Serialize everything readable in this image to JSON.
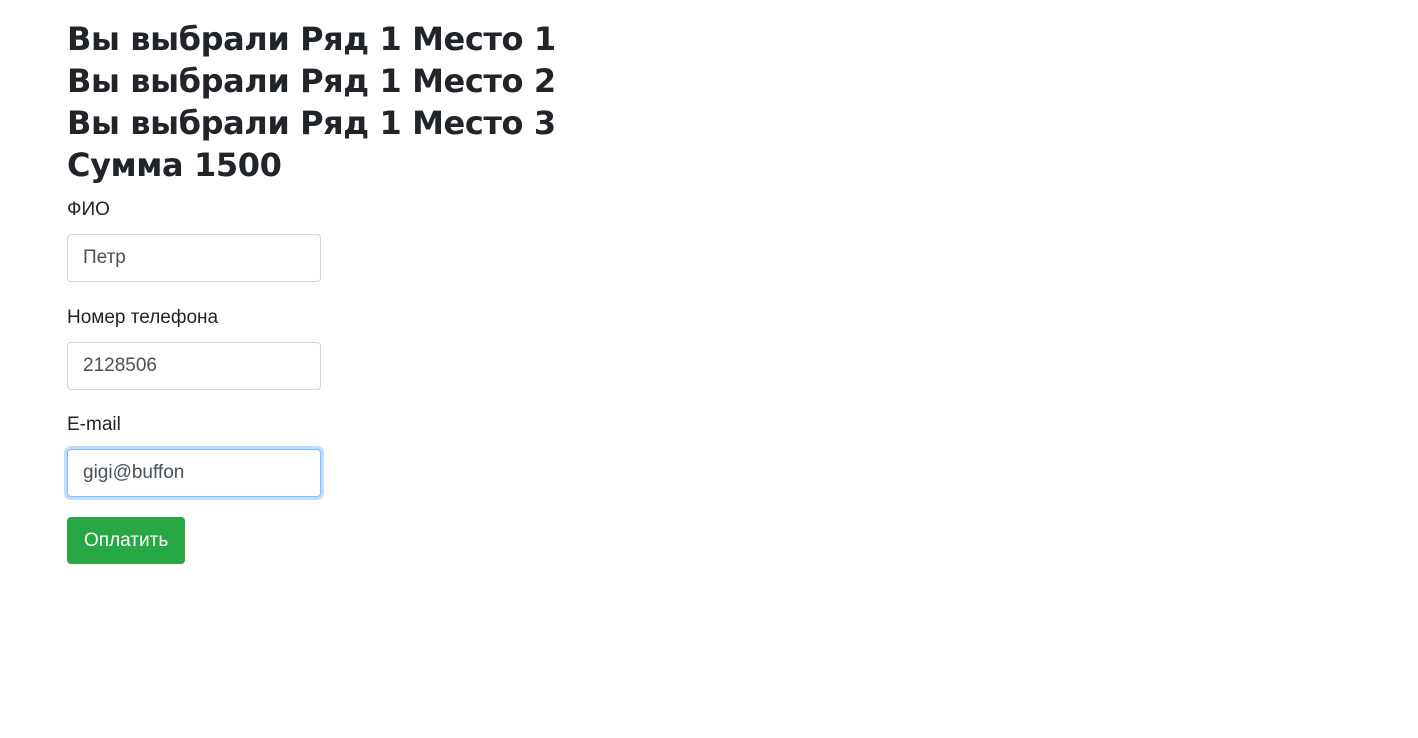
{
  "selection": {
    "lines": [
      "Вы выбрали Ряд 1 Место 1",
      "Вы выбрали Ряд 1 Место 2",
      "Вы выбрали Ряд 1 Место 3"
    ],
    "total": "Сумма 1500"
  },
  "form": {
    "name": {
      "label": "ФИО",
      "value": "Петр"
    },
    "phone": {
      "label": "Номер телефона",
      "value": "2128506"
    },
    "email": {
      "label": "E-mail",
      "value": "gigi@buffon"
    },
    "submit_label": "Оплатить"
  },
  "colors": {
    "button_bg": "#28a745",
    "focus_border": "#80bdff"
  }
}
